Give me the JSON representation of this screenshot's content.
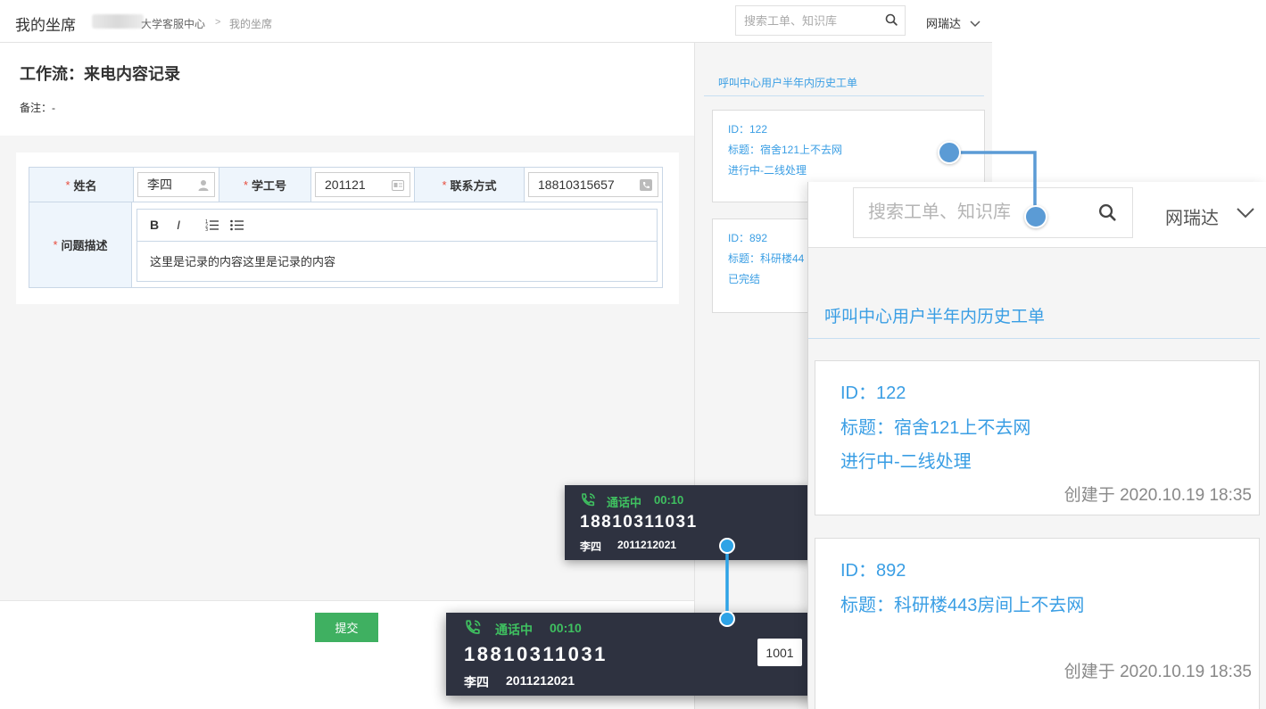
{
  "header": {
    "app_title": "我的坐席",
    "breadcrumb_org": "大学客服中心",
    "breadcrumb_sep": ">",
    "breadcrumb_current": "我的坐席",
    "search_placeholder": "搜索工单、知识库",
    "user_name": "网瑞达"
  },
  "workflow": {
    "title": "工作流：来电内容记录",
    "note": "备注：-"
  },
  "form": {
    "required_mark": "*",
    "name_label": "姓名",
    "name_value": "李四",
    "id_label": "学工号",
    "id_value": "201121",
    "contact_label": "联系方式",
    "contact_value": "18810315657",
    "desc_label": "问题描述",
    "toolbar": {
      "bold": "B",
      "italic": "I"
    },
    "desc_value": "这里是记录的内容这里是记录的内容",
    "submit_label": "提交"
  },
  "sidebar": {
    "title": "呼叫中心用户半年内历史工单",
    "tickets": [
      {
        "id": "ID：122",
        "title": "标题：宿舍121上不去网",
        "status": "进行中-二线处理",
        "created": "创建于 2020.10.19   18:35"
      },
      {
        "id": "ID：892",
        "title": "标题：科研楼443房间上不去网",
        "title_short": "标题：科研楼44",
        "status": "已完结",
        "created": "创建于 2020.10.19   18:35"
      }
    ]
  },
  "call": {
    "status": "通话中",
    "duration": "00:10",
    "number": "18810311031",
    "caller_name": "李四",
    "caller_id": "2011212021",
    "extension": "1001"
  },
  "colors": {
    "accent_blue": "#3a9ee4",
    "call_green": "#3fc060",
    "hangup_red": "#e25555",
    "callbar_bg": "#2e3240",
    "submit_green": "#3fb061"
  }
}
